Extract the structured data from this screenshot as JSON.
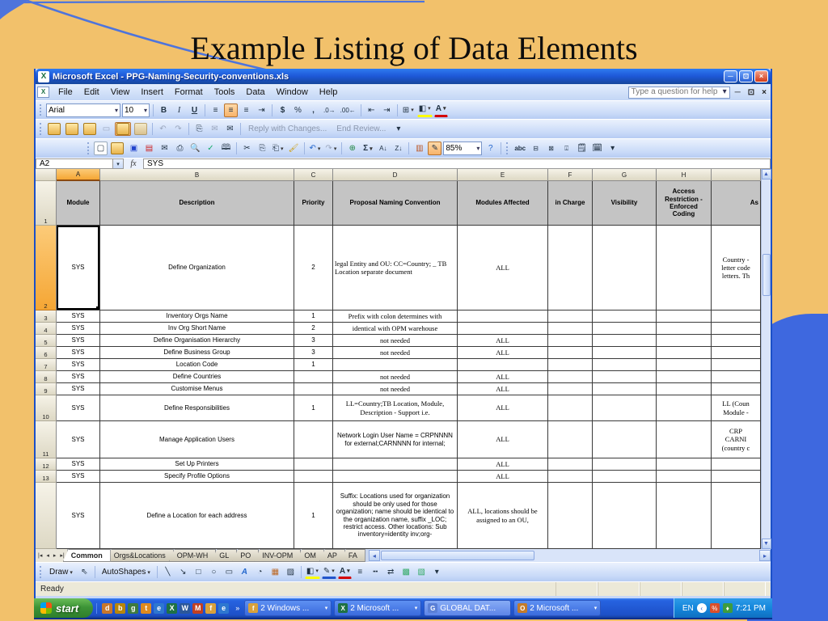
{
  "slide": {
    "title": "Example Listing of Data Elements"
  },
  "colors": {
    "slide_bg": "#F2C16B",
    "accent_blue": "#3E68DF",
    "titlebar_blue": "#1D57D6",
    "taskbar_blue": "#2663E0",
    "start_green": "#3D9437",
    "selection_orange": "#F5A634",
    "header_gray": "#C4C4C4"
  },
  "window": {
    "title": "Microsoft Excel - PPG-Naming-Security-conventions.xls",
    "question_box": "Type a question for help"
  },
  "menu": {
    "items": [
      "File",
      "Edit",
      "View",
      "Insert",
      "Format",
      "Tools",
      "Data",
      "Window",
      "Help"
    ]
  },
  "formatting_toolbar": {
    "font_name": "Arial",
    "font_size": "10"
  },
  "reviewing_toolbar": {
    "reply_label": "Reply with Changes...",
    "end_label": "End Review..."
  },
  "standard_toolbar": {
    "zoom": "85%"
  },
  "formula_bar": {
    "name_box": "A2",
    "fx": "fx",
    "value": "SYS"
  },
  "sheet": {
    "col_letters": [
      "",
      "A",
      "B",
      "C",
      "D",
      "E",
      "F",
      "G",
      "H",
      ""
    ],
    "header_cells": [
      "Module",
      "Description",
      "Priority",
      "Proposal Naming Convention",
      "Modules Affected",
      "in Charge",
      "Visibility",
      "Access Restriction - Enforced Coding",
      "As"
    ],
    "header_num": "1",
    "rows": [
      {
        "num": "2",
        "cells": [
          "SYS",
          "Define Organization",
          "2",
          "legal Entity and OU: CC=Country; _ TB Location separate document",
          "ALL",
          "",
          "",
          "",
          "Country -\nletter code\nletters. Th"
        ]
      },
      {
        "num": "3",
        "cells": [
          "SYS",
          "Inventory Orgs Name",
          "1",
          "Prefix with colon determines with",
          "",
          "",
          "",
          "",
          ""
        ]
      },
      {
        "num": "4",
        "cells": [
          "SYS",
          "Inv Org Short Name",
          "2",
          "identical with OPM warehouse",
          "",
          "",
          "",
          "",
          ""
        ]
      },
      {
        "num": "5",
        "cells": [
          "SYS",
          "Define Organisation Hierarchy",
          "3",
          "not needed",
          "ALL",
          "",
          "",
          "",
          ""
        ]
      },
      {
        "num": "6",
        "cells": [
          "SYS",
          "Define Business Group",
          "3",
          "not needed",
          "ALL",
          "",
          "",
          "",
          ""
        ]
      },
      {
        "num": "7",
        "cells": [
          "SYS",
          "Location Code",
          "1",
          "",
          "",
          "",
          "",
          "",
          ""
        ]
      },
      {
        "num": "8",
        "cells": [
          "SYS",
          "Define Countries",
          "",
          "not needed",
          "ALL",
          "",
          "",
          "",
          ""
        ]
      },
      {
        "num": "9",
        "cells": [
          "SYS",
          "Customise Menus",
          "",
          "not needed",
          "ALL",
          "",
          "",
          "",
          ""
        ]
      },
      {
        "num": "10",
        "cells": [
          "SYS",
          "Define Responsibilities",
          "1",
          "LL=Country;TB Location, Module, Description - Support i.e.",
          "ALL",
          "",
          "",
          "",
          "LL (Coun\nModule -"
        ]
      },
      {
        "num": "11",
        "cells": [
          "SYS",
          "Manage Application Users",
          "",
          "Network Login User Name = CRPNNNN for external;CARNNNN for internal;",
          "ALL",
          "",
          "",
          "",
          "CRP\nCARNI\n(country c"
        ]
      },
      {
        "num": "12",
        "cells": [
          "SYS",
          "Set Up Printers",
          "",
          "",
          "ALL",
          "",
          "",
          "",
          ""
        ]
      },
      {
        "num": "13",
        "cells": [
          "SYS",
          "Specify Profile Options",
          "",
          "",
          "ALL",
          "",
          "",
          "",
          ""
        ]
      },
      {
        "num": "",
        "cells": [
          "SYS",
          "Define a Location for each address",
          "1",
          "Suffix: Locations used for organization should be only used for those organization; name should be identical to the organization name, suffix _LOC; restrict access.  Other locations: Sub inventory=identity inv;org-",
          "ALL, locations should be assigned to an OU,",
          "",
          "",
          "",
          ""
        ]
      }
    ]
  },
  "sheet_tabs": {
    "active": "Common",
    "items": [
      "Common",
      "Orgs&Locations",
      "OPM-WH",
      "GL",
      "PO",
      "INV-OPM",
      "OM",
      "AP",
      "FA"
    ]
  },
  "draw_toolbar": {
    "draw_label": "Draw",
    "autoshapes_label": "AutoShapes"
  },
  "status_bar": {
    "text": "Ready"
  },
  "taskbar": {
    "start_label": "start",
    "quick_launch": [
      {
        "name": "show-desktop-icon",
        "color": "#C9772B",
        "glyph": "d"
      },
      {
        "name": "briefcase-icon",
        "color": "#B8860B",
        "glyph": "b"
      },
      {
        "name": "globe-icon",
        "color": "#3E7A3E",
        "glyph": "g"
      },
      {
        "name": "clock-icon",
        "color": "#E08A1E",
        "glyph": "t"
      },
      {
        "name": "ie-icon",
        "color": "#2E77D0",
        "glyph": "e"
      },
      {
        "name": "excel-icon",
        "color": "#1E7145",
        "glyph": "X"
      },
      {
        "name": "word-icon",
        "color": "#2B579A",
        "glyph": "W"
      },
      {
        "name": "msn-icon",
        "color": "#C24022",
        "glyph": "M"
      },
      {
        "name": "folder-icon",
        "color": "#D9A13B",
        "glyph": "f"
      },
      {
        "name": "ie2-icon",
        "color": "#2E77D0",
        "glyph": "e"
      }
    ],
    "buttons": [
      {
        "label": "2 Windows ...",
        "icon_glyph": "f",
        "icon_color": "#D9A13B",
        "dropdown": true,
        "lighter": false
      },
      {
        "label": "2 Microsoft ...",
        "icon_glyph": "X",
        "icon_color": "#1E7145",
        "dropdown": true,
        "lighter": false
      },
      {
        "label": "GLOBAL DAT...",
        "icon_glyph": "G",
        "icon_color": "#5A7FD6",
        "dropdown": false,
        "lighter": true
      },
      {
        "label": "2 Microsoft ...",
        "icon_glyph": "O",
        "icon_color": "#C47B2A",
        "dropdown": true,
        "lighter": false
      }
    ],
    "language": "EN",
    "time": "7:21 PM"
  }
}
